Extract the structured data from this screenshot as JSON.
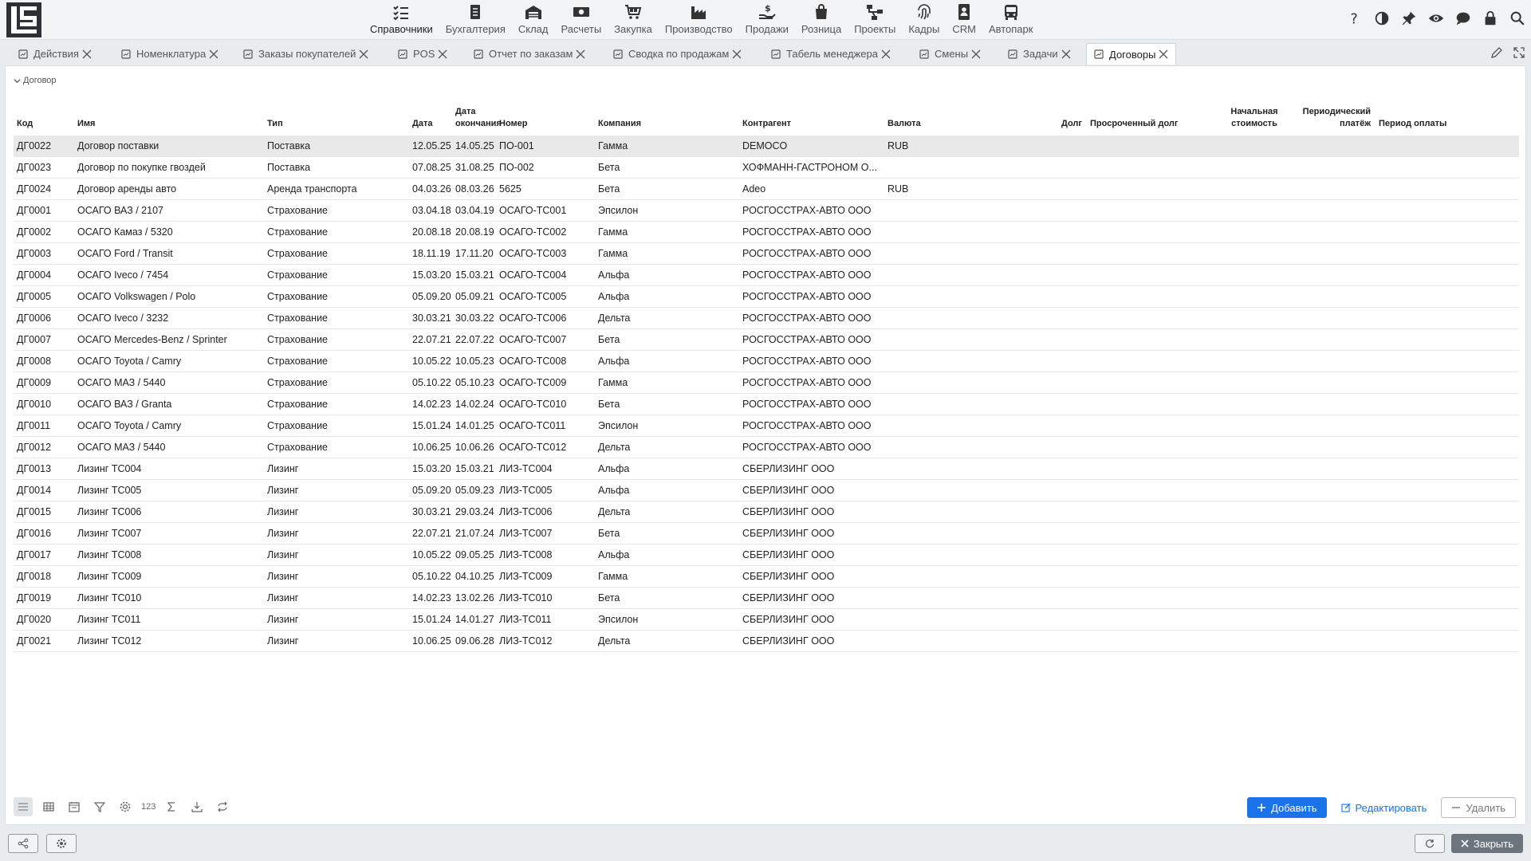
{
  "nav": {
    "items": [
      {
        "label": "Справочники",
        "icon": "list-check-icon"
      },
      {
        "label": "Бухгалтерия",
        "icon": "ledger-icon"
      },
      {
        "label": "Склад",
        "icon": "warehouse-icon"
      },
      {
        "label": "Расчеты",
        "icon": "money-icon"
      },
      {
        "label": "Закупка",
        "icon": "cart-icon"
      },
      {
        "label": "Производство",
        "icon": "factory-icon"
      },
      {
        "label": "Продажи",
        "icon": "sales-hand-icon"
      },
      {
        "label": "Розница",
        "icon": "bag-icon"
      },
      {
        "label": "Проекты",
        "icon": "project-tree-icon"
      },
      {
        "label": "Кадры",
        "icon": "fingerprint-icon"
      },
      {
        "label": "CRM",
        "icon": "contact-card-icon"
      },
      {
        "label": "Автопарк",
        "icon": "bus-icon"
      }
    ]
  },
  "tabs": [
    {
      "label": "Действия"
    },
    {
      "label": "Номенклатура"
    },
    {
      "label": "Заказы покупателей"
    },
    {
      "label": "POS"
    },
    {
      "label": "Отчет по заказам"
    },
    {
      "label": "Сводка по продажам"
    },
    {
      "label": "Табель менеджера"
    },
    {
      "label": "Смены"
    },
    {
      "label": "Задачи"
    },
    {
      "label": "Договоры"
    }
  ],
  "breadcrumb": "Договор",
  "columns": {
    "code": "Код",
    "name": "Имя",
    "type": "Тип",
    "date": "Дата",
    "end_date": "Дата окончания",
    "number": "Номер",
    "company": "Компания",
    "counterparty": "Контрагент",
    "currency": "Валюта",
    "debt": "Долг",
    "overdue": "Просроченный долг",
    "initial_cost": "Начальная стоимость",
    "periodic": "Периодический платёж",
    "period": "Период оплаты"
  },
  "rows": [
    {
      "code": "ДГ0022",
      "name": "Договор поставки",
      "type": "Поставка",
      "date": "12.05.25",
      "end": "14.05.25",
      "number": "ПО-001",
      "company": "Гамма",
      "cp": "DEMOCO",
      "cur": "RUB"
    },
    {
      "code": "ДГ0023",
      "name": "Договор по покупке гвоздей",
      "type": "Поставка",
      "date": "07.08.25",
      "end": "31.08.25",
      "number": "ПО-002",
      "company": "Бета",
      "cp": "ХОФМАНН-ГАСТРОНОМ О...",
      "cur": ""
    },
    {
      "code": "ДГ0024",
      "name": "Договор аренды авто",
      "type": "Аренда транспорта",
      "date": "04.03.26",
      "end": "08.03.26",
      "number": "5625",
      "company": "Бета",
      "cp": "Adeo",
      "cur": "RUB"
    },
    {
      "code": "ДГ0001",
      "name": "ОСАГО ВАЗ / 2107",
      "type": "Страхование",
      "date": "03.04.18",
      "end": "03.04.19",
      "number": "ОСАГО-ТС001",
      "company": "Эпсилон",
      "cp": "РОСГОССТРАХ-АВТО ООО",
      "cur": ""
    },
    {
      "code": "ДГ0002",
      "name": "ОСАГО Камаз / 5320",
      "type": "Страхование",
      "date": "20.08.18",
      "end": "20.08.19",
      "number": "ОСАГО-ТС002",
      "company": "Гамма",
      "cp": "РОСГОССТРАХ-АВТО ООО",
      "cur": ""
    },
    {
      "code": "ДГ0003",
      "name": "ОСАГО Ford / Transit",
      "type": "Страхование",
      "date": "18.11.19",
      "end": "17.11.20",
      "number": "ОСАГО-ТС003",
      "company": "Гамма",
      "cp": "РОСГОССТРАХ-АВТО ООО",
      "cur": ""
    },
    {
      "code": "ДГ0004",
      "name": "ОСАГО Iveco / 7454",
      "type": "Страхование",
      "date": "15.03.20",
      "end": "15.03.21",
      "number": "ОСАГО-ТС004",
      "company": "Альфа",
      "cp": "РОСГОССТРАХ-АВТО ООО",
      "cur": ""
    },
    {
      "code": "ДГ0005",
      "name": "ОСАГО Volkswagen / Polo",
      "type": "Страхование",
      "date": "05.09.20",
      "end": "05.09.21",
      "number": "ОСАГО-ТС005",
      "company": "Альфа",
      "cp": "РОСГОССТРАХ-АВТО ООО",
      "cur": ""
    },
    {
      "code": "ДГ0006",
      "name": "ОСАГО Iveco / 3232",
      "type": "Страхование",
      "date": "30.03.21",
      "end": "30.03.22",
      "number": "ОСАГО-ТС006",
      "company": "Дельта",
      "cp": "РОСГОССТРАХ-АВТО ООО",
      "cur": ""
    },
    {
      "code": "ДГ0007",
      "name": "ОСАГО Mercedes-Benz / Sprinter",
      "type": "Страхование",
      "date": "22.07.21",
      "end": "22.07.22",
      "number": "ОСАГО-ТС007",
      "company": "Бета",
      "cp": "РОСГОССТРАХ-АВТО ООО",
      "cur": ""
    },
    {
      "code": "ДГ0008",
      "name": "ОСАГО Toyota / Camry",
      "type": "Страхование",
      "date": "10.05.22",
      "end": "10.05.23",
      "number": "ОСАГО-ТС008",
      "company": "Альфа",
      "cp": "РОСГОССТРАХ-АВТО ООО",
      "cur": ""
    },
    {
      "code": "ДГ0009",
      "name": "ОСАГО МАЗ / 5440",
      "type": "Страхование",
      "date": "05.10.22",
      "end": "05.10.23",
      "number": "ОСАГО-ТС009",
      "company": "Гамма",
      "cp": "РОСГОССТРАХ-АВТО ООО",
      "cur": ""
    },
    {
      "code": "ДГ0010",
      "name": "ОСАГО ВАЗ / Granta",
      "type": "Страхование",
      "date": "14.02.23",
      "end": "14.02.24",
      "number": "ОСАГО-ТС010",
      "company": "Бета",
      "cp": "РОСГОССТРАХ-АВТО ООО",
      "cur": ""
    },
    {
      "code": "ДГ0011",
      "name": "ОСАГО Toyota / Camry",
      "type": "Страхование",
      "date": "15.01.24",
      "end": "14.01.25",
      "number": "ОСАГО-ТС011",
      "company": "Эпсилон",
      "cp": "РОСГОССТРАХ-АВТО ООО",
      "cur": ""
    },
    {
      "code": "ДГ0012",
      "name": "ОСАГО МАЗ / 5440",
      "type": "Страхование",
      "date": "10.06.25",
      "end": "10.06.26",
      "number": "ОСАГО-ТС012",
      "company": "Дельта",
      "cp": "РОСГОССТРАХ-АВТО ООО",
      "cur": ""
    },
    {
      "code": "ДГ0013",
      "name": "Лизинг ТС004",
      "type": "Лизинг",
      "date": "15.03.20",
      "end": "15.03.21",
      "number": "ЛИЗ-ТС004",
      "company": "Альфа",
      "cp": "СБЕРЛИЗИНГ ООО",
      "cur": ""
    },
    {
      "code": "ДГ0014",
      "name": "Лизинг ТС005",
      "type": "Лизинг",
      "date": "05.09.20",
      "end": "05.09.23",
      "number": "ЛИЗ-ТС005",
      "company": "Альфа",
      "cp": "СБЕРЛИЗИНГ ООО",
      "cur": ""
    },
    {
      "code": "ДГ0015",
      "name": "Лизинг ТС006",
      "type": "Лизинг",
      "date": "30.03.21",
      "end": "29.03.24",
      "number": "ЛИЗ-ТС006",
      "company": "Дельта",
      "cp": "СБЕРЛИЗИНГ ООО",
      "cur": ""
    },
    {
      "code": "ДГ0016",
      "name": "Лизинг ТС007",
      "type": "Лизинг",
      "date": "22.07.21",
      "end": "21.07.24",
      "number": "ЛИЗ-ТС007",
      "company": "Бета",
      "cp": "СБЕРЛИЗИНГ ООО",
      "cur": ""
    },
    {
      "code": "ДГ0017",
      "name": "Лизинг ТС008",
      "type": "Лизинг",
      "date": "10.05.22",
      "end": "09.05.25",
      "number": "ЛИЗ-ТС008",
      "company": "Альфа",
      "cp": "СБЕРЛИЗИНГ ООО",
      "cur": ""
    },
    {
      "code": "ДГ0018",
      "name": "Лизинг ТС009",
      "type": "Лизинг",
      "date": "05.10.22",
      "end": "04.10.25",
      "number": "ЛИЗ-ТС009",
      "company": "Гамма",
      "cp": "СБЕРЛИЗИНГ ООО",
      "cur": ""
    },
    {
      "code": "ДГ0019",
      "name": "Лизинг ТС010",
      "type": "Лизинг",
      "date": "14.02.23",
      "end": "13.02.26",
      "number": "ЛИЗ-ТС010",
      "company": "Бета",
      "cp": "СБЕРЛИЗИНГ ООО",
      "cur": ""
    },
    {
      "code": "ДГ0020",
      "name": "Лизинг ТС011",
      "type": "Лизинг",
      "date": "15.01.24",
      "end": "14.01.27",
      "number": "ЛИЗ-ТС011",
      "company": "Эпсилон",
      "cp": "СБЕРЛИЗИНГ ООО",
      "cur": ""
    },
    {
      "code": "ДГ0021",
      "name": "Лизинг ТС012",
      "type": "Лизинг",
      "date": "10.06.25",
      "end": "09.06.28",
      "number": "ЛИЗ-ТС012",
      "company": "Дельта",
      "cp": "СБЕРЛИЗИНГ ООО",
      "cur": ""
    }
  ],
  "toolbar": {
    "numbers_label": "123"
  },
  "actions": {
    "add": "Добавить",
    "edit": "Редактировать",
    "delete": "Удалить"
  },
  "footer": {
    "close": "Закрыть"
  },
  "colors": {
    "accent": "#1a73e8",
    "selected_row": "#e9e9e9"
  }
}
